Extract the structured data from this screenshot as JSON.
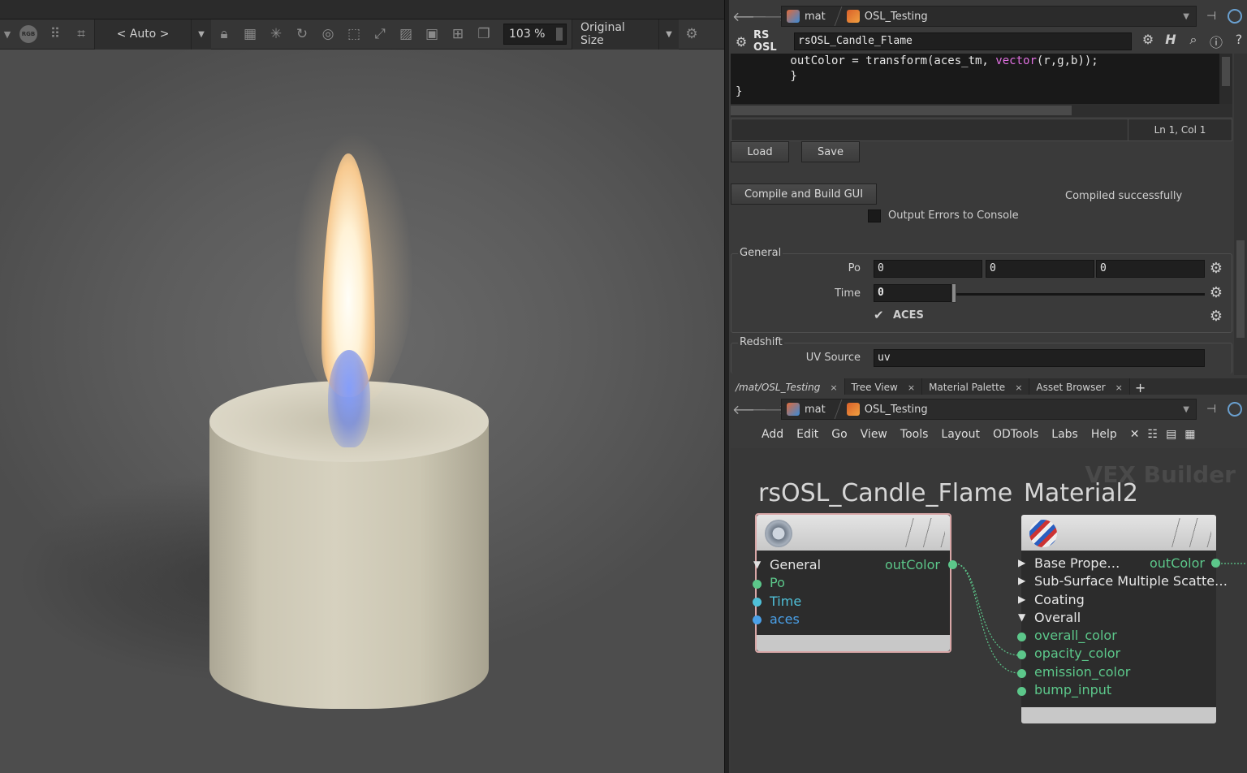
{
  "render_view": {
    "toolbar": {
      "rgb_badge": "RGB",
      "zoom_mode": "< Auto >",
      "zoom_percent": "103 %",
      "size_mode": "Original Size"
    }
  },
  "param_pane": {
    "path": {
      "context": "mat",
      "node": "OSL_Testing"
    },
    "node_type": "RS OSL",
    "node_name": "rsOSL_Candle_Flame",
    "code_lines": [
      "        outColor = transform(aces_tm, vector(r,g,b));",
      "        }",
      "}"
    ],
    "cursor_position": "Ln 1, Col 1",
    "load_label": "Load",
    "save_label": "Save",
    "compile_label": "Compile and Build GUI",
    "compile_status": "Compiled successfully",
    "output_errors_label": "Output Errors to Console",
    "general_group": "General",
    "po_label": "Po",
    "po_values": [
      "0",
      "0",
      "0"
    ],
    "time_label": "Time",
    "time_value": "0",
    "aces_label": "ACES",
    "redshift_group": "Redshift",
    "uv_source_label": "UV Source",
    "uv_source_value": "uv"
  },
  "tabs": [
    {
      "label": "/mat/OSL_Testing"
    },
    {
      "label": "Tree View"
    },
    {
      "label": "Material Palette"
    },
    {
      "label": "Asset Browser"
    }
  ],
  "network": {
    "path": {
      "context": "mat",
      "node": "OSL_Testing"
    },
    "menu": [
      "Add",
      "Edit",
      "Go",
      "View",
      "Tools",
      "Layout",
      "ODTools",
      "Labs",
      "Help"
    ],
    "watermark": "VEX Builder",
    "node1": {
      "title": "rsOSL_Candle_Flame",
      "group": "General",
      "output": "outColor",
      "inputs": [
        "Po",
        "Time",
        "aces"
      ]
    },
    "node2": {
      "title": "Material2",
      "output": "outColor",
      "sections": [
        "Base Prope…",
        "Sub-Surface Multiple Scatte…",
        "Coating",
        "Overall"
      ],
      "inputs": [
        "overall_color",
        "opacity_color",
        "emission_color",
        "bump_input"
      ]
    }
  },
  "colors": {
    "port_green": "#5cc78a",
    "port_cyan": "#4fc0d8",
    "port_blue": "#4aa0e8",
    "keyword_magenta": "#e070e0",
    "selected_node_border": "#d9a7a7"
  }
}
